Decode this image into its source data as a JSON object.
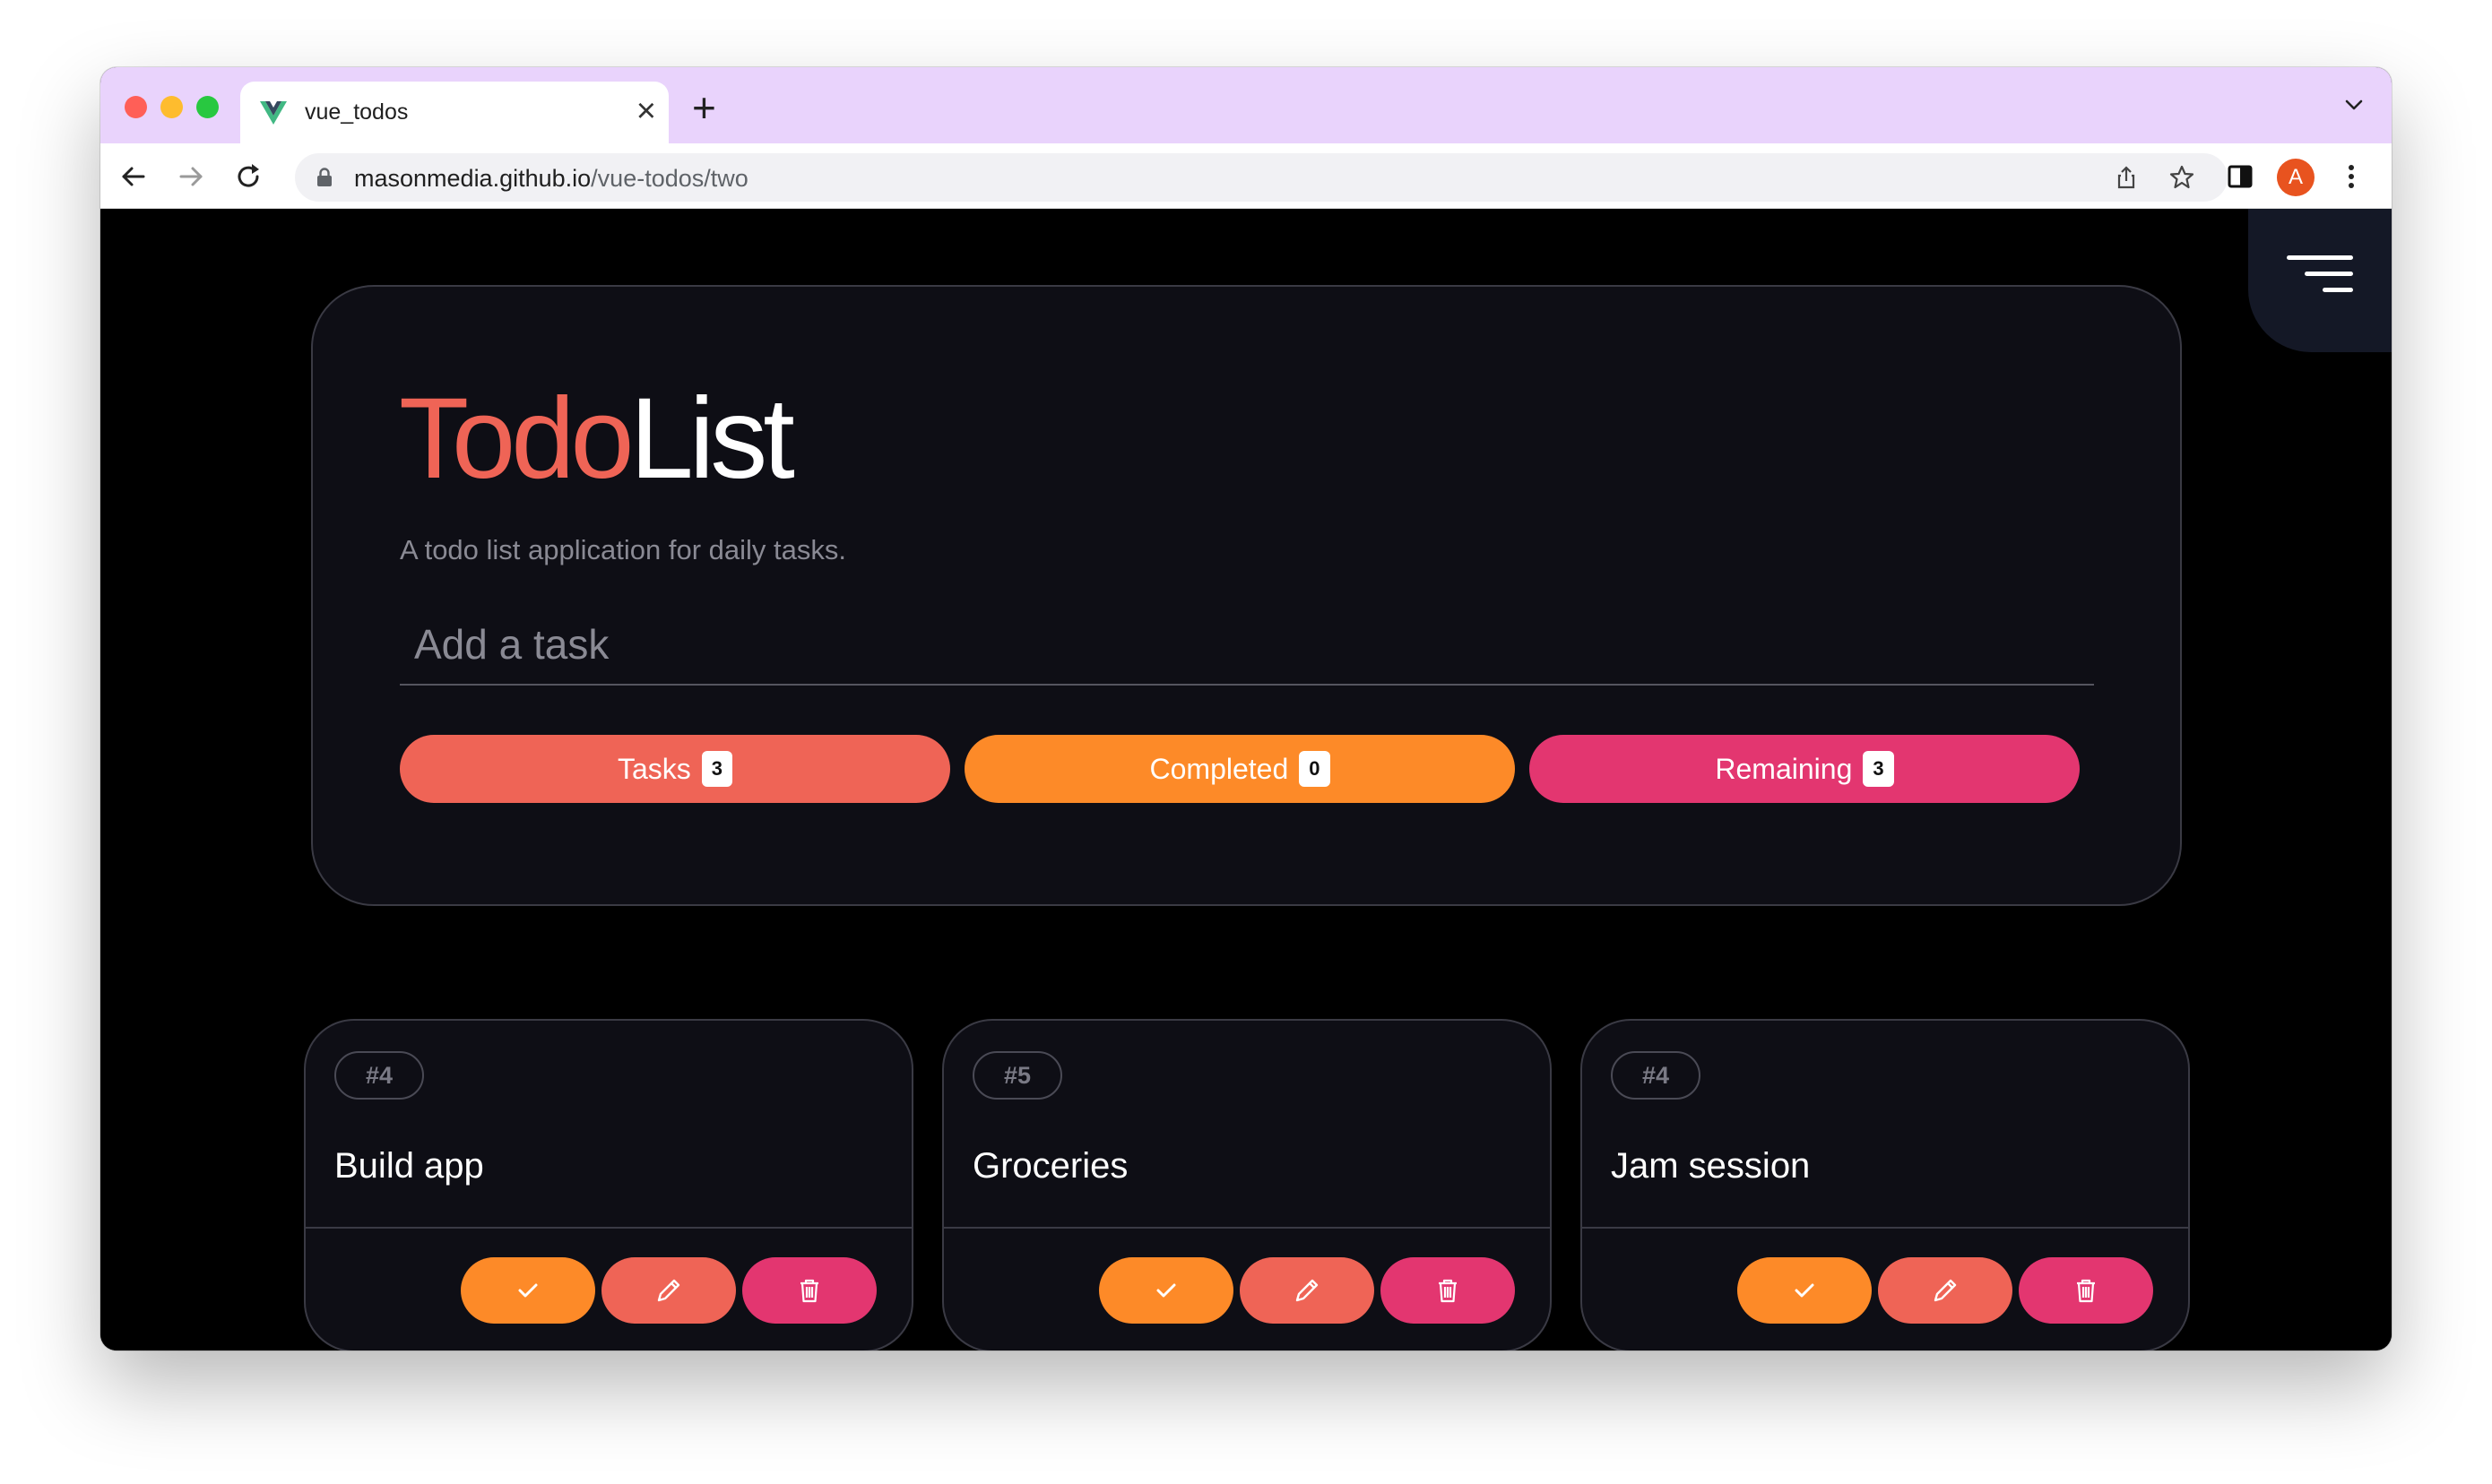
{
  "browser": {
    "tab_title": "vue_todos",
    "tab_close": "×",
    "new_tab": "+",
    "url_host": "masonmedia.github.io",
    "url_path": "/vue-todos/two",
    "profile_initial": "A"
  },
  "app": {
    "title_part1": "Todo",
    "title_part2": "List",
    "subtitle": "A todo list application for daily tasks.",
    "input_placeholder": "Add a task",
    "stats": {
      "tasks_label": "Tasks",
      "tasks_count": "3",
      "completed_label": "Completed",
      "completed_count": "0",
      "remaining_label": "Remaining",
      "remaining_count": "3"
    },
    "cards": [
      {
        "id": "#4",
        "title": "Build app"
      },
      {
        "id": "#5",
        "title": "Groceries"
      },
      {
        "id": "#4",
        "title": "Jam session"
      }
    ]
  },
  "colors": {
    "accent_coral": "#ef6456",
    "accent_orange": "#fd8a28",
    "accent_pink": "#e33670",
    "tabstrip": "#e9d3fc"
  },
  "icons": {
    "menu": "hamburger-menu-icon",
    "done": "check-icon",
    "edit": "pencil-icon",
    "delete": "trash-icon"
  }
}
